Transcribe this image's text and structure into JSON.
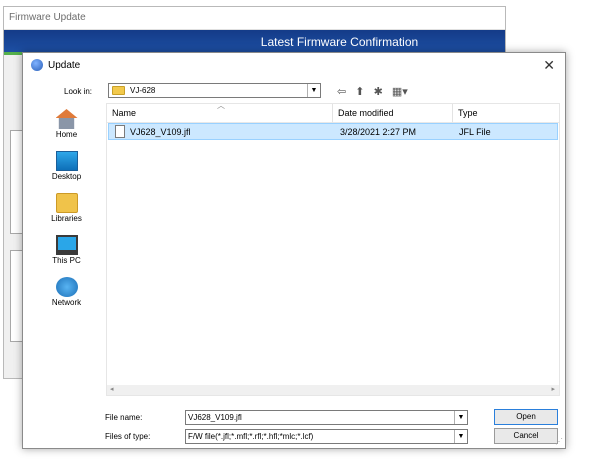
{
  "background_window": {
    "title": "Firmware Update",
    "banner": "Latest Firmware Confirmation"
  },
  "dialog": {
    "title": "Update",
    "close_glyph": "✕",
    "look_in_label": "Look in:",
    "look_in_value": "VJ-628",
    "places": [
      {
        "label": "Home"
      },
      {
        "label": "Desktop"
      },
      {
        "label": "Libraries"
      },
      {
        "label": "This PC"
      },
      {
        "label": "Network"
      }
    ],
    "columns": {
      "name": "Name",
      "date_modified": "Date modified",
      "type": "Type"
    },
    "files": [
      {
        "name": "VJ628_V109.jfl",
        "date": "3/28/2021 2:27 PM",
        "type": "JFL File"
      }
    ],
    "file_name_label": "File name:",
    "file_name_value": "VJ628_V109.jfl",
    "files_of_type_label": "Files of type:",
    "files_of_type_value": "F/W file(*.jfl;*.mfl;*.rfl;*.hfl;*mlc;*.lcf)",
    "open_label": "Open",
    "cancel_label": "Cancel"
  },
  "icons": {
    "back": "back-arrow-icon",
    "up": "up-folder-icon",
    "new_folder": "new-folder-icon",
    "view": "view-menu-icon"
  },
  "colors": {
    "banner": "#1d4fa3",
    "selection": "#cce8ff",
    "folder": "#f2c94c"
  }
}
